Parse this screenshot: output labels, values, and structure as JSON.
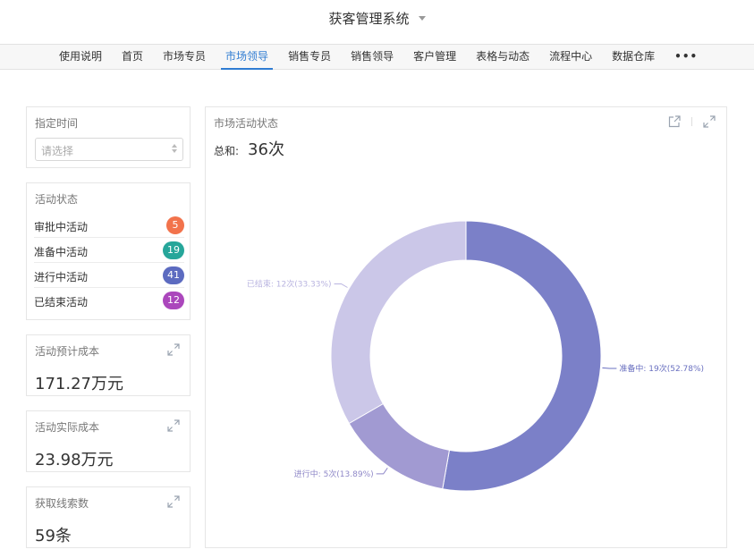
{
  "app": {
    "title": "获客管理系统"
  },
  "nav": {
    "items": [
      {
        "label": "使用说明"
      },
      {
        "label": "首页"
      },
      {
        "label": "市场专员"
      },
      {
        "label": "市场领导",
        "active": true
      },
      {
        "label": "销售专员"
      },
      {
        "label": "销售领导"
      },
      {
        "label": "客户管理"
      },
      {
        "label": "表格与动态"
      },
      {
        "label": "流程中心"
      },
      {
        "label": "数据仓库"
      },
      {
        "label": "•••"
      }
    ]
  },
  "filter": {
    "title": "指定时间",
    "placeholder": "请选择"
  },
  "status_panel": {
    "title": "活动状态",
    "items": [
      {
        "label": "审批中活动",
        "count": "5",
        "color": "#f2734c"
      },
      {
        "label": "准备中活动",
        "count": "19",
        "color": "#26a69a"
      },
      {
        "label": "进行中活动",
        "count": "41",
        "color": "#5c6bc0"
      },
      {
        "label": "已结束活动",
        "count": "12",
        "color": "#ab47bc"
      }
    ]
  },
  "metrics": [
    {
      "title": "活动预计成本",
      "value": "171.27万元"
    },
    {
      "title": "活动实际成本",
      "value": "23.98万元"
    },
    {
      "title": "获取线索数",
      "value": "59条"
    }
  ],
  "chart_panel": {
    "title": "市场活动状态",
    "sum_label": "总和:",
    "sum_value": "36次"
  },
  "chart_data": {
    "type": "pie",
    "series": [
      {
        "name": "准备中",
        "value": 19,
        "label": "准备中: 19次(52.78%)",
        "color": "#7b80c8",
        "label_color": "#6a70c0"
      },
      {
        "name": "进行中",
        "value": 5,
        "label": "进行中: 5次(13.89%)",
        "color": "#a19ad2",
        "label_color": "#8f88c8"
      },
      {
        "name": "已结束",
        "value": 12,
        "label": "已结束: 12次(33.33%)",
        "color": "#cbc7e8",
        "label_color": "#b9b4e0"
      }
    ]
  }
}
